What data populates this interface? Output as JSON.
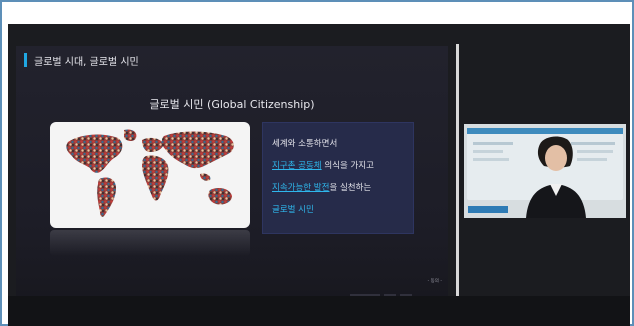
{
  "slide": {
    "title": "글로벌 시대, 글로벌 시민",
    "subtitle": "글로벌 시민 (Global Citizenship)",
    "text": {
      "line1": "세계와 소통하면서",
      "line2_highlight": "지구촌 공동체",
      "line2_rest": " 의식을 가지고",
      "line3_highlight": "지속가능한 발전",
      "line3_rest": "을 실천하는",
      "line4_highlight": "글로벌 시민"
    },
    "footer": "- 동의 -"
  },
  "colors": {
    "accent": "#20a7e2",
    "slide_bg": "#1e1e28",
    "text_card_bg": "#282e50",
    "frame_border": "#5d8fb8"
  },
  "icons": {
    "map": "world-map-of-people-icon",
    "person": "presenter-webcam"
  }
}
